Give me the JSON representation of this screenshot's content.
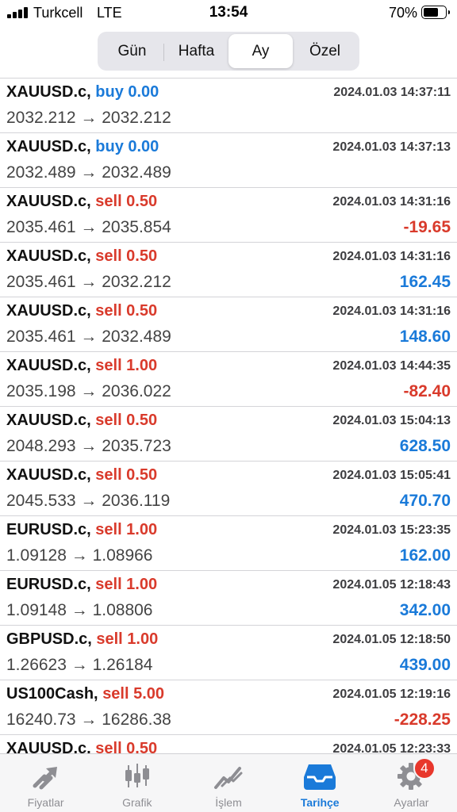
{
  "status_bar": {
    "carrier": "Turkcell",
    "network": "LTE",
    "time": "13:54",
    "battery_percent": "70%",
    "battery_level": 0.7
  },
  "period_tabs": [
    {
      "label": "Gün",
      "active": false
    },
    {
      "label": "Hafta",
      "active": false
    },
    {
      "label": "Ay",
      "active": true
    },
    {
      "label": "Özel",
      "active": false
    }
  ],
  "colors": {
    "buy": "#1a7ad9",
    "sell": "#d93a2b",
    "profit_positive": "#1a7ad9",
    "profit_negative": "#d93a2b",
    "tab_active": "#1a7ad9"
  },
  "deals": [
    {
      "symbol": "XAUUSD.c,",
      "side": "buy 0.00",
      "type": "buy",
      "time": "2024.01.03 14:37:11",
      "prices": "2032.212 → 2032.212",
      "profit": "",
      "sign": ""
    },
    {
      "symbol": "XAUUSD.c,",
      "side": "buy 0.00",
      "type": "buy",
      "time": "2024.01.03 14:37:13",
      "prices": "2032.489 → 2032.489",
      "profit": "",
      "sign": ""
    },
    {
      "symbol": "XAUUSD.c,",
      "side": "sell 0.50",
      "type": "sell",
      "time": "2024.01.03 14:31:16",
      "prices": "2035.461 → 2035.854",
      "profit": "-19.65",
      "sign": "neg"
    },
    {
      "symbol": "XAUUSD.c,",
      "side": "sell 0.50",
      "type": "sell",
      "time": "2024.01.03 14:31:16",
      "prices": "2035.461 → 2032.212",
      "profit": "162.45",
      "sign": "pos"
    },
    {
      "symbol": "XAUUSD.c,",
      "side": "sell 0.50",
      "type": "sell",
      "time": "2024.01.03 14:31:16",
      "prices": "2035.461 → 2032.489",
      "profit": "148.60",
      "sign": "pos"
    },
    {
      "symbol": "XAUUSD.c,",
      "side": "sell 1.00",
      "type": "sell",
      "time": "2024.01.03 14:44:35",
      "prices": "2035.198 → 2036.022",
      "profit": "-82.40",
      "sign": "neg"
    },
    {
      "symbol": "XAUUSD.c,",
      "side": "sell 0.50",
      "type": "sell",
      "time": "2024.01.03 15:04:13",
      "prices": "2048.293 → 2035.723",
      "profit": "628.50",
      "sign": "pos"
    },
    {
      "symbol": "XAUUSD.c,",
      "side": "sell 0.50",
      "type": "sell",
      "time": "2024.01.03 15:05:41",
      "prices": "2045.533 → 2036.119",
      "profit": "470.70",
      "sign": "pos"
    },
    {
      "symbol": "EURUSD.c,",
      "side": "sell 1.00",
      "type": "sell",
      "time": "2024.01.03 15:23:35",
      "prices": "1.09128 → 1.08966",
      "profit": "162.00",
      "sign": "pos"
    },
    {
      "symbol": "EURUSD.c,",
      "side": "sell 1.00",
      "type": "sell",
      "time": "2024.01.05 12:18:43",
      "prices": "1.09148 → 1.08806",
      "profit": "342.00",
      "sign": "pos"
    },
    {
      "symbol": "GBPUSD.c,",
      "side": "sell 1.00",
      "type": "sell",
      "time": "2024.01.05 12:18:50",
      "prices": "1.26623 → 1.26184",
      "profit": "439.00",
      "sign": "pos"
    },
    {
      "symbol": "US100Cash,",
      "side": "sell 5.00",
      "type": "sell",
      "time": "2024.01.05 12:19:16",
      "prices": "16240.73 → 16286.38",
      "profit": "-228.25",
      "sign": "neg"
    },
    {
      "symbol": "XAUUSD.c,",
      "side": "sell 0.50",
      "type": "sell",
      "time": "2024.01.05 12:23:33",
      "prices": "",
      "profit": "",
      "sign": ""
    }
  ],
  "bottom_tabs": [
    {
      "label": "Fiyatlar",
      "icon": "quotes-icon",
      "active": false
    },
    {
      "label": "Grafik",
      "icon": "chart-icon",
      "active": false
    },
    {
      "label": "İşlem",
      "icon": "trade-icon",
      "active": false
    },
    {
      "label": "Tarihçe",
      "icon": "history-icon",
      "active": true
    },
    {
      "label": "Ayarlar",
      "icon": "settings-icon",
      "active": false,
      "badge": "4"
    }
  ]
}
